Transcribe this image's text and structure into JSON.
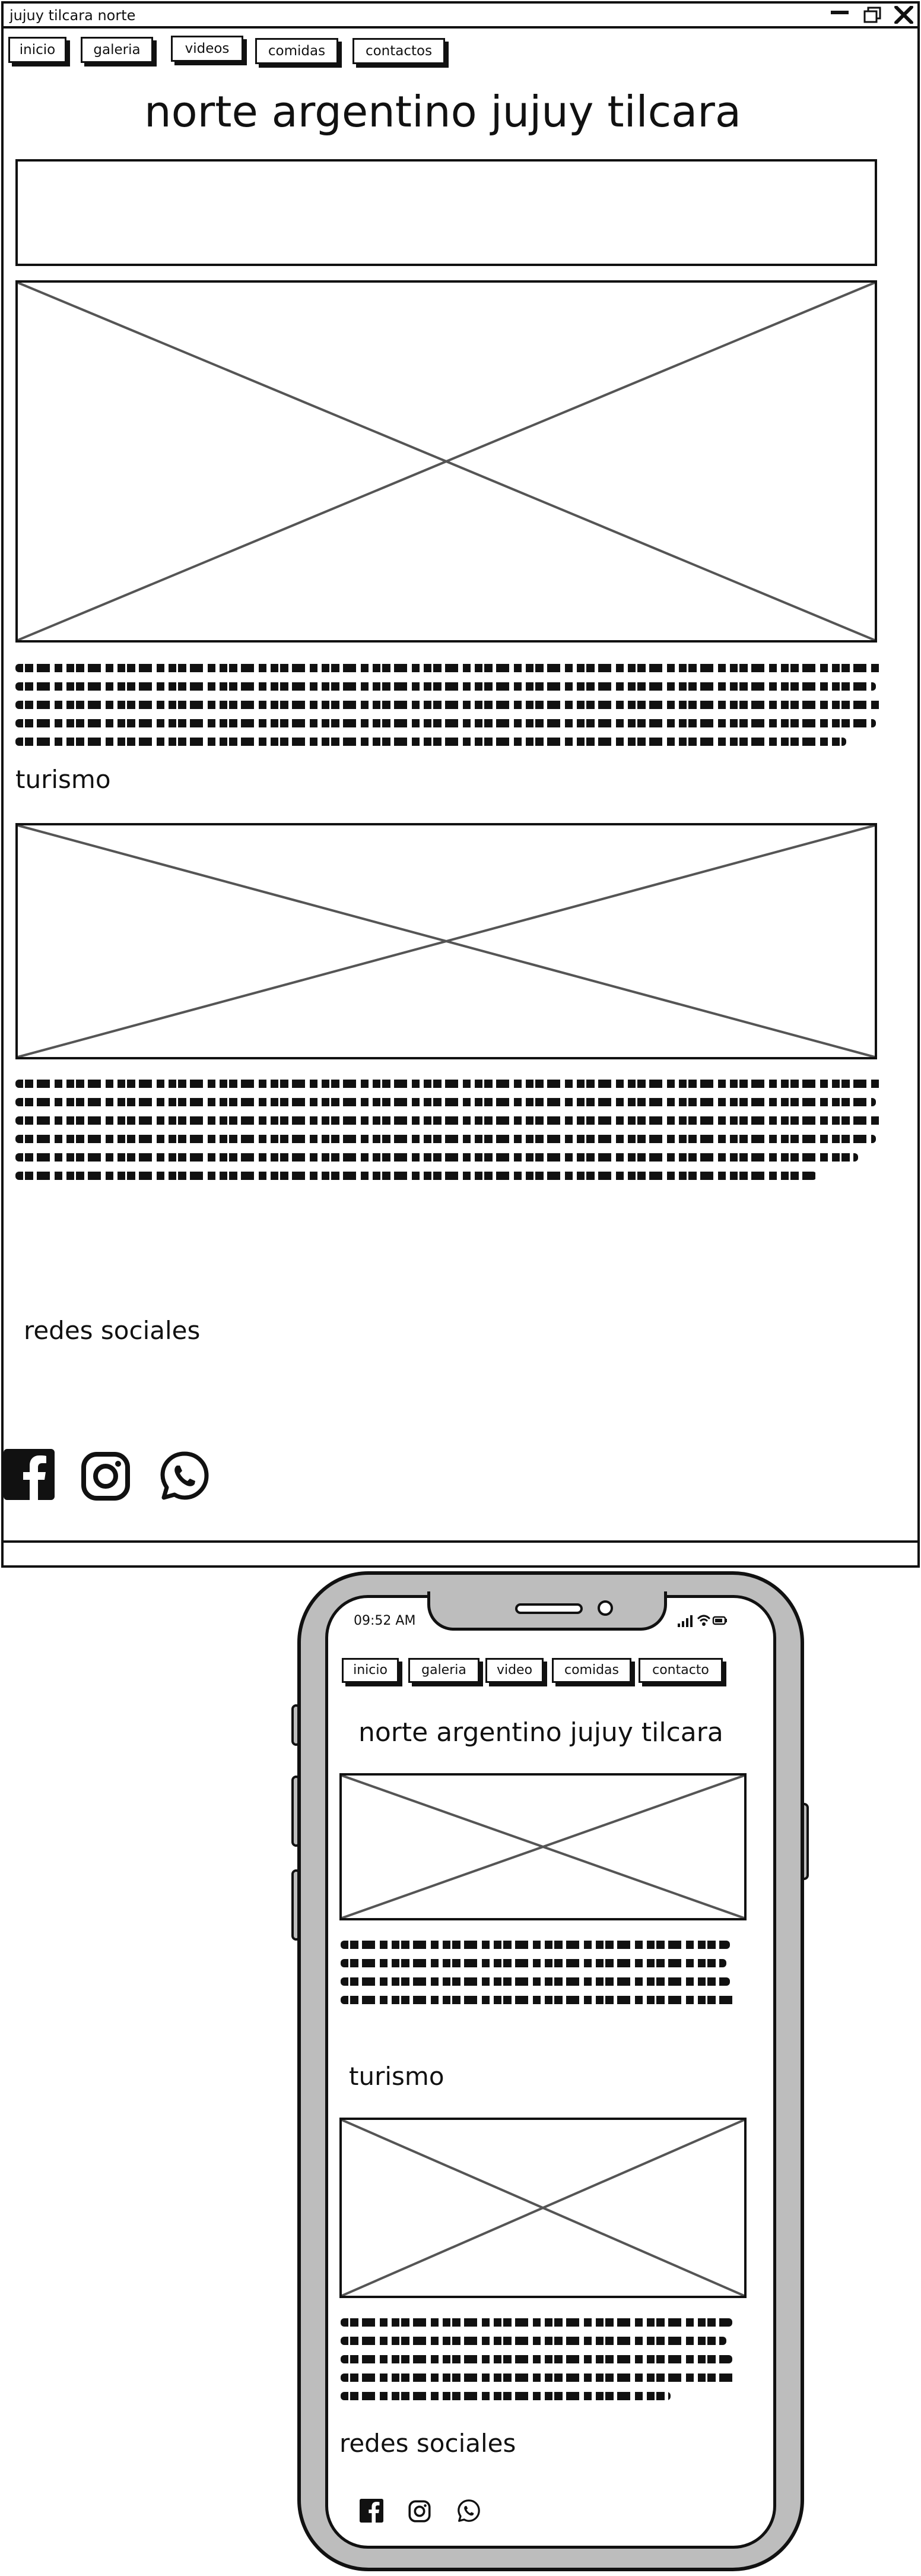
{
  "window": {
    "title": "jujuy tilcara norte"
  },
  "nav": {
    "desktop": [
      "inicio",
      "galeria",
      "videos",
      "comidas",
      "contactos"
    ],
    "mobile": [
      "inicio",
      "galeria",
      "video",
      "comidas",
      "contacto"
    ]
  },
  "page": {
    "heading": "norte argentino jujuy tilcara",
    "section_turismo": "turismo",
    "section_redes": "redes sociales"
  },
  "phone": {
    "status_time": "09:52 AM"
  },
  "icons": {
    "social": [
      "facebook-icon",
      "instagram-icon",
      "whatsapp-icon"
    ]
  }
}
